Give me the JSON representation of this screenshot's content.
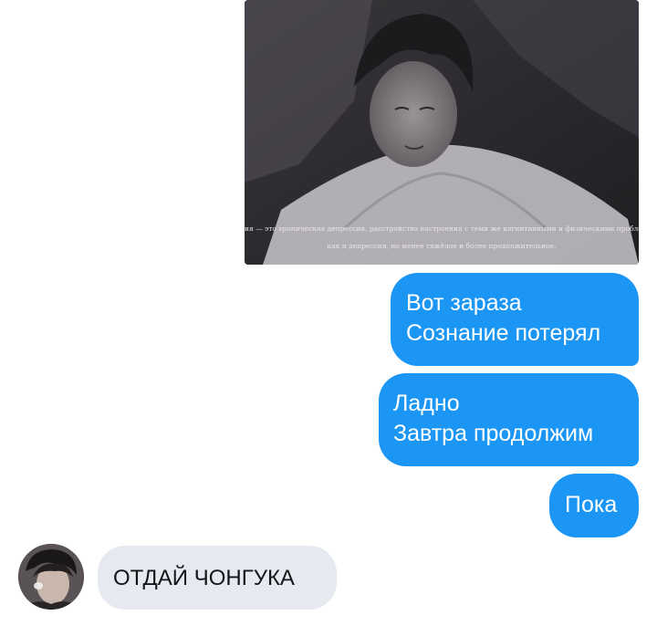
{
  "conversation": {
    "photo": {
      "caption_lines": [
        "ия — это хроническая депрессия, расстройство настроения с теми же когнитивными и физическими пробле",
        "как и депрессия, но менее тяжёлое и более продолжительное."
      ]
    },
    "outgoing_messages": [
      {
        "lines": [
          "Вот зараза",
          "Сознание потерял"
        ]
      },
      {
        "lines": [
          "Ладно",
          "Завтра продолжим"
        ]
      },
      {
        "lines": [
          "Пока"
        ]
      }
    ],
    "incoming_messages": [
      {
        "lines": [
          "ОТДАЙ ЧОНГУКА"
        ]
      }
    ]
  },
  "colors": {
    "outgoing_bubble": "#1c96f4",
    "incoming_bubble": "#e6e9ef",
    "background": "#ffffff"
  }
}
